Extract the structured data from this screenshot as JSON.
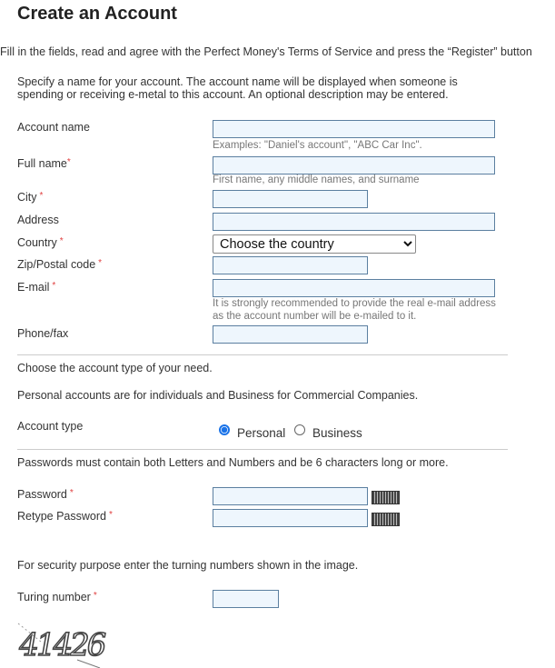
{
  "title": "Create an Account",
  "intro": "Fill in the fields, read and agree with the Perfect Money's Terms of Service and press the “Register” button",
  "account_desc_1": "Specify a name for your account. The account name will be displayed when someone is",
  "account_desc_2": "spending or receiving e-metal to this account. An optional description may be entered.",
  "required_mark": "*",
  "fields": {
    "account_name": {
      "label": "Account name",
      "value": "",
      "hint": "Examples: \"Daniel's account\", \"ABC Car Inc\"."
    },
    "full_name": {
      "label": "Full name",
      "value": "",
      "hint": "First name, any middle names, and surname"
    },
    "city": {
      "label": "City",
      "value": ""
    },
    "address": {
      "label": "Address",
      "value": ""
    },
    "country": {
      "label": "Country",
      "selected": "Choose the country"
    },
    "zip": {
      "label": "Zip/Postal code",
      "value": ""
    },
    "email": {
      "label": "E-mail",
      "value": "",
      "hint1": "It is strongly recommended to provide the real e-mail address",
      "hint2": "as the account number will be e-mailed to it."
    },
    "phone": {
      "label": "Phone/fax",
      "value": ""
    }
  },
  "account_type_intro": "Choose the account type of your need.",
  "account_type_desc": "Personal accounts are for individuals and Business for Commercial Companies.",
  "account_type": {
    "label": "Account type",
    "options": [
      "Personal",
      "Business"
    ],
    "selected": "Personal"
  },
  "password_rule": "Passwords must contain both Letters and Numbers and be 6 characters long or more.",
  "password": {
    "label": "Password",
    "value": ""
  },
  "retype_password": {
    "label": "Retype Password",
    "value": ""
  },
  "security_text": "For security purpose enter the turning numbers shown in the image.",
  "turing": {
    "label": "Turing number",
    "value": "",
    "captcha_text": "41426"
  },
  "colors": {
    "input_bg": "#eef6fd",
    "input_border": "#5b7fa0",
    "required": "#e04040",
    "radio": "#1a73e8"
  }
}
